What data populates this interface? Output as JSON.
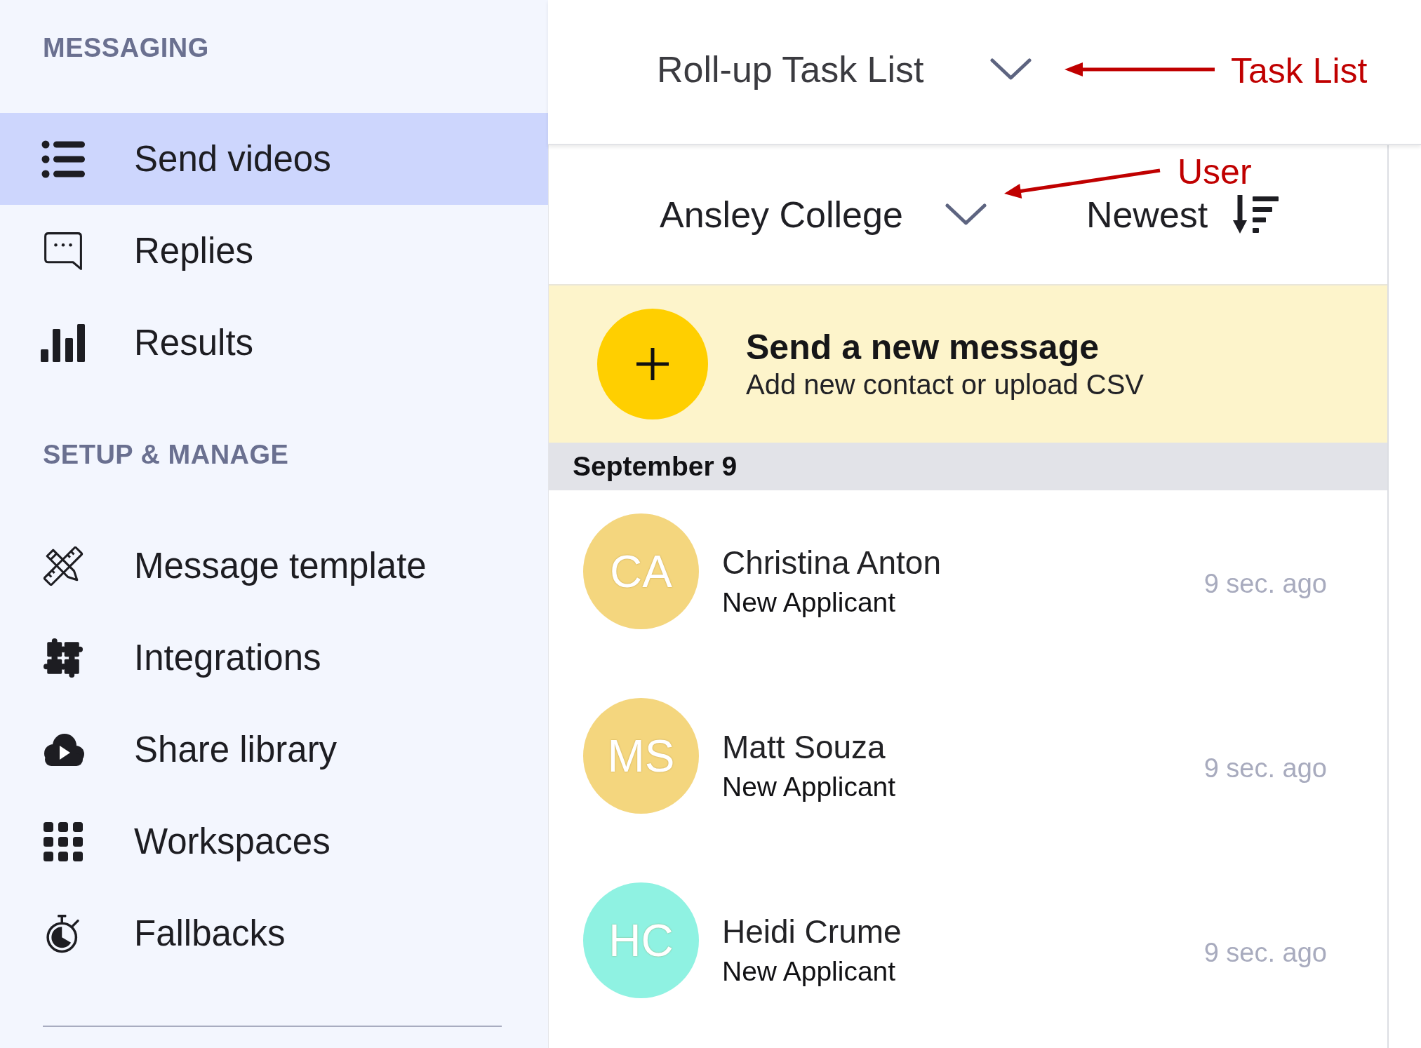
{
  "sidebar": {
    "sections": [
      {
        "title": "MESSAGING",
        "items": [
          {
            "label": "Send videos",
            "selected": true
          },
          {
            "label": "Replies",
            "selected": false
          },
          {
            "label": "Results",
            "selected": false
          }
        ]
      },
      {
        "title": "SETUP & MANAGE",
        "items": [
          {
            "label": "Message template",
            "selected": false
          },
          {
            "label": "Integrations",
            "selected": false
          },
          {
            "label": "Share library",
            "selected": false
          },
          {
            "label": "Workspaces",
            "selected": false
          },
          {
            "label": "Fallbacks",
            "selected": false
          }
        ]
      }
    ]
  },
  "header": {
    "task_list_dropdown": {
      "label": "Roll-up Task List"
    }
  },
  "toolbar": {
    "account_dropdown": {
      "label": "Ansley College"
    },
    "sort_button": {
      "label": "Newest"
    }
  },
  "new_message_banner": {
    "title": "Send a new message",
    "subtitle": "Add new contact or upload CSV"
  },
  "contacts": {
    "date_header": "September 9",
    "rows": [
      {
        "initials": "CA",
        "name": "Christina Anton",
        "status": "New Applicant",
        "time": "9 sec. ago",
        "color": "#f4d67e"
      },
      {
        "initials": "MS",
        "name": "Matt Souza",
        "status": "New Applicant",
        "time": "9 sec. ago",
        "color": "#f4d67e"
      },
      {
        "initials": "HC",
        "name": "Heidi Crume",
        "status": "New Applicant",
        "time": "9 sec. ago",
        "color": "#8ff2e2"
      }
    ]
  },
  "annotations": [
    {
      "text": "Task List"
    },
    {
      "text": "User"
    }
  ]
}
